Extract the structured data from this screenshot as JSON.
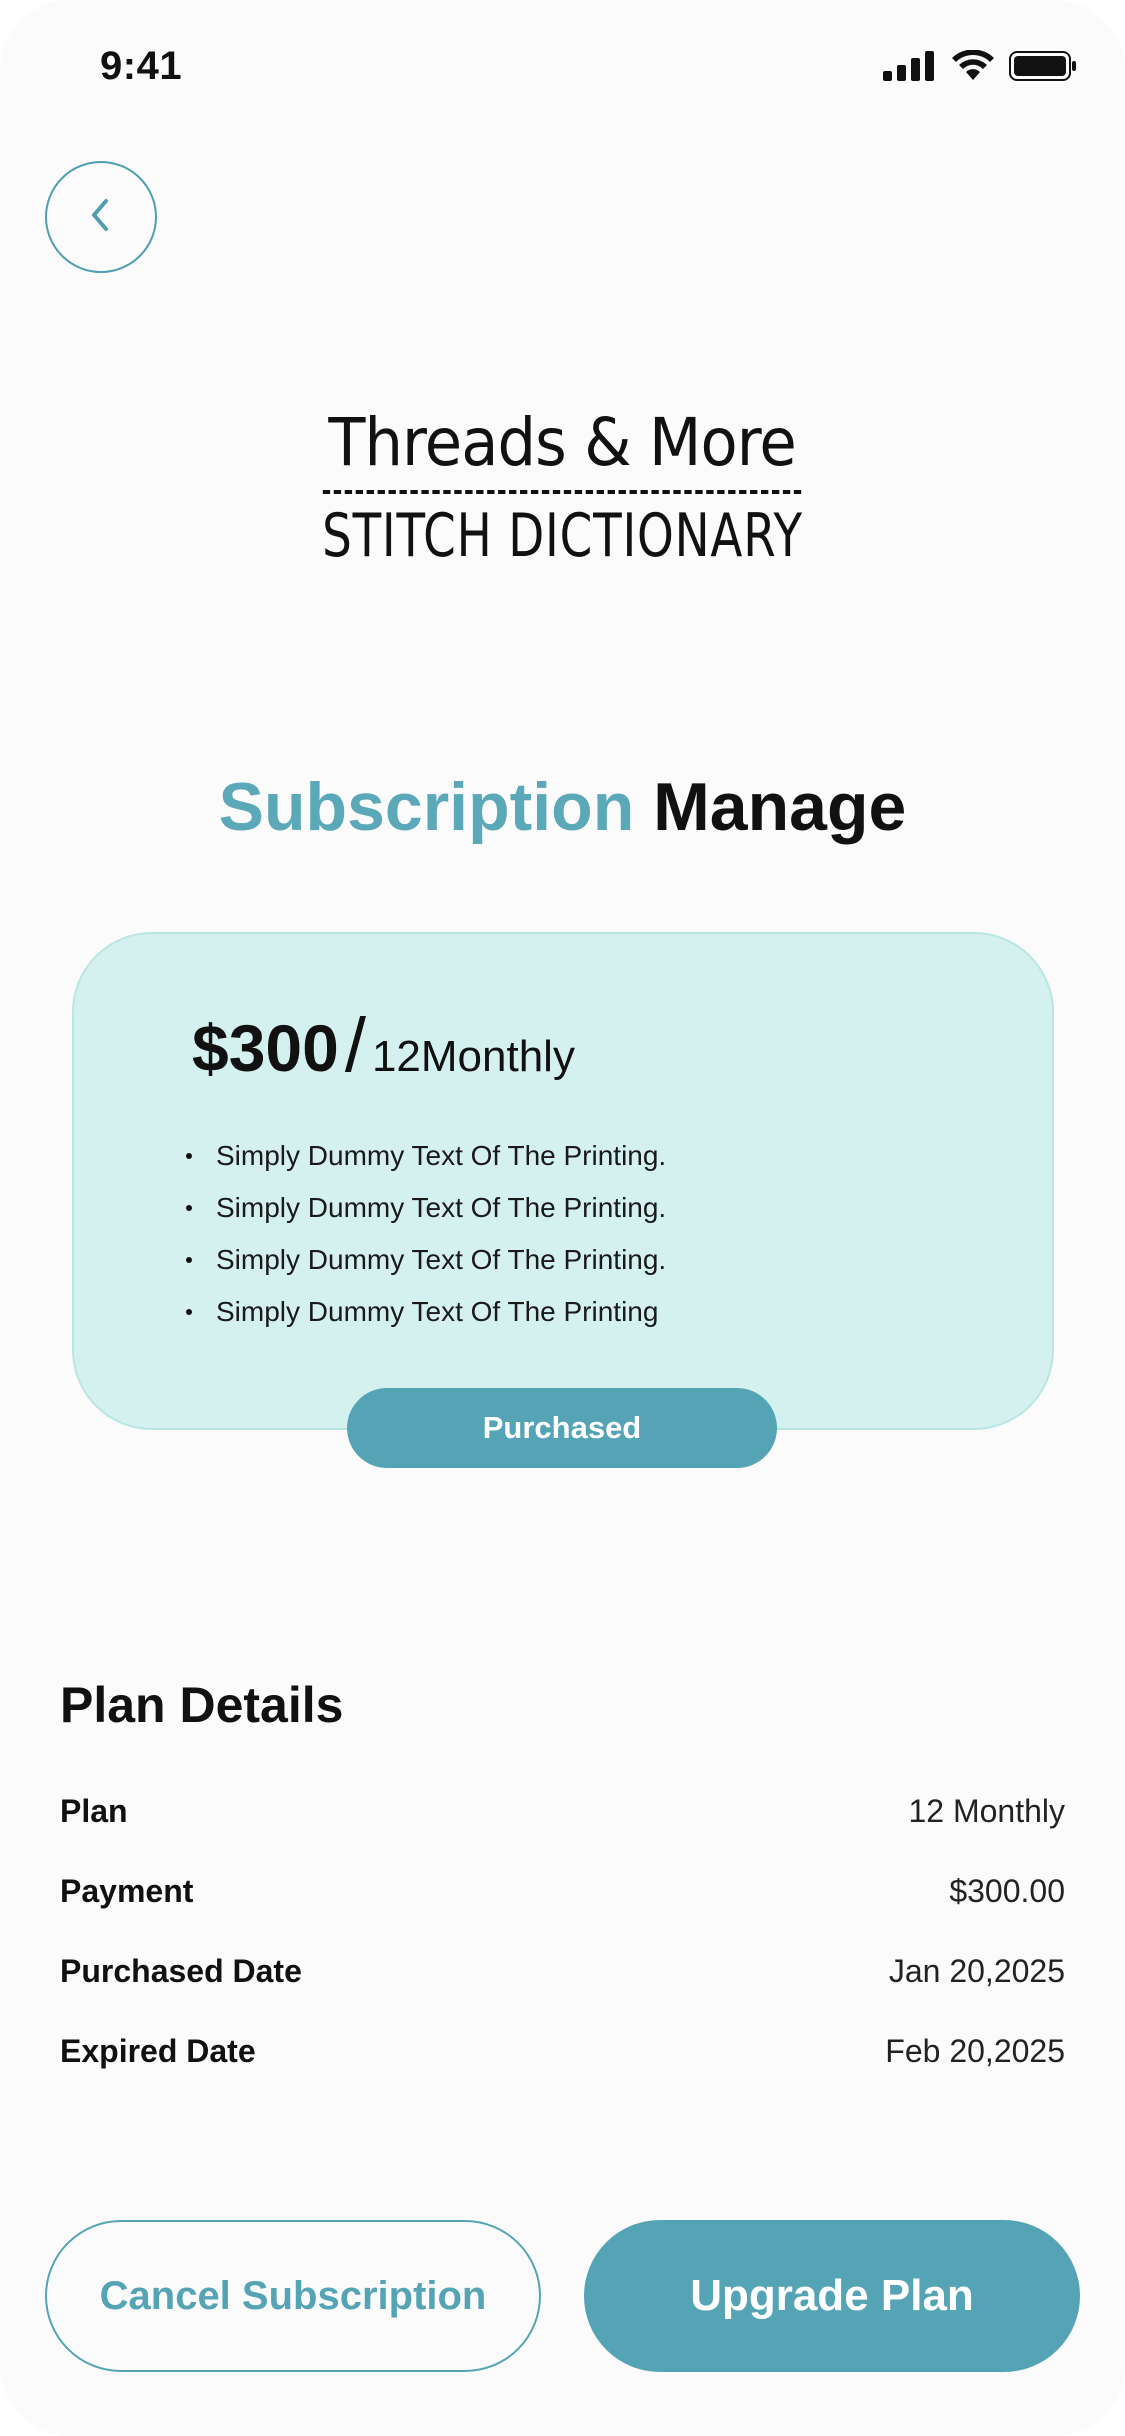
{
  "status_bar": {
    "time": "9:41",
    "icons": [
      "signal-icon",
      "wifi-icon",
      "battery-icon"
    ]
  },
  "header": {
    "back_icon": "chevron-left-icon"
  },
  "logo": {
    "line1": "Threads & More",
    "line2": "STITCH DICTIONARY"
  },
  "title": {
    "accent": "Subscription",
    "rest": "Manage"
  },
  "plan_card": {
    "price": "$300",
    "slash": "/",
    "period": "12Monthly",
    "features": [
      "Simply Dummy Text Of The Printing.",
      "Simply Dummy Text Of The Printing.",
      "Simply Dummy Text Of The Printing.",
      "Simply Dummy Text Of The Printing"
    ],
    "badge": "Purchased"
  },
  "plan_details": {
    "title": "Plan Details",
    "rows": [
      {
        "label": "Plan",
        "value": "12 Monthly"
      },
      {
        "label": "Payment",
        "value": "$300.00"
      },
      {
        "label": "Purchased Date",
        "value": "Jan 20,2025"
      },
      {
        "label": "Expired Date",
        "value": "Feb 20,2025"
      }
    ]
  },
  "actions": {
    "cancel_label": "Cancel Subscription",
    "upgrade_label": "Upgrade Plan"
  },
  "colors": {
    "accent": "#55a4b5",
    "card_bg": "#d4f1f0",
    "text": "#111111",
    "background": "#fbfbfb"
  }
}
